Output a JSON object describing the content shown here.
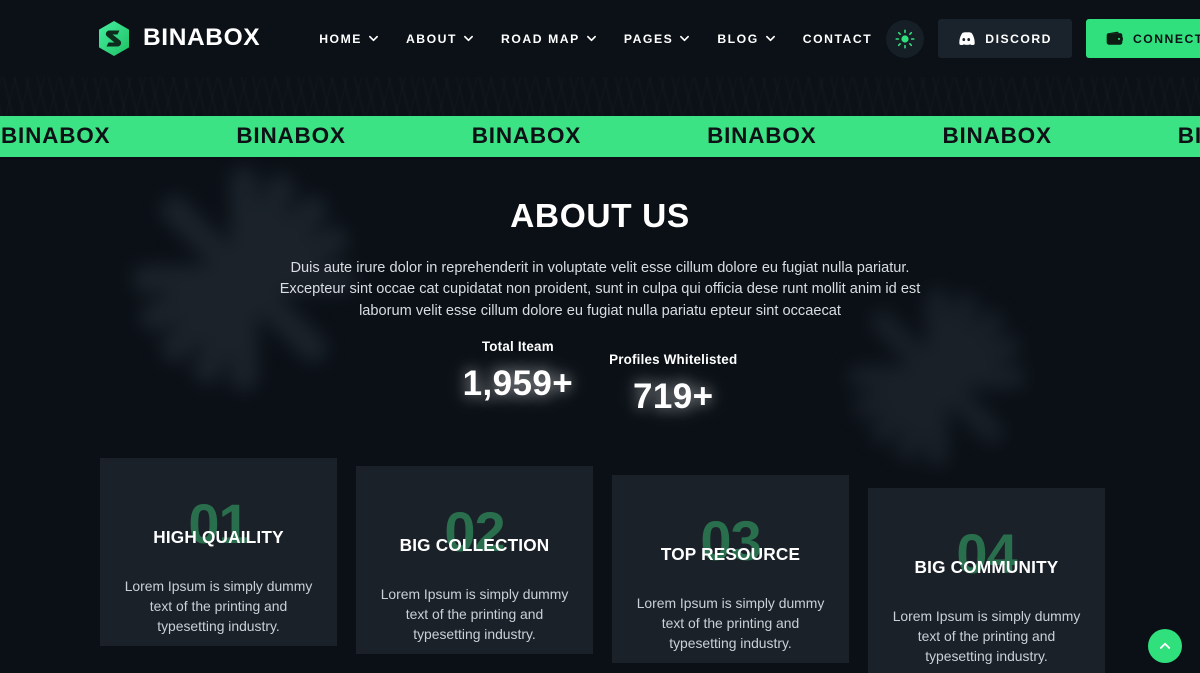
{
  "brand": {
    "name": "BINABOX",
    "logo_icon": "binabox-hexagon-logo-icon",
    "accent_color": "#2fe07c"
  },
  "header": {
    "nav": [
      {
        "label": "HOME",
        "has_dropdown": true
      },
      {
        "label": "ABOUT",
        "has_dropdown": true
      },
      {
        "label": "ROAD MAP",
        "has_dropdown": true
      },
      {
        "label": "PAGES",
        "has_dropdown": true
      },
      {
        "label": "BLOG",
        "has_dropdown": true
      },
      {
        "label": "CONTACT",
        "has_dropdown": false
      }
    ],
    "theme_toggle_icon": "sun-icon",
    "discord_button": {
      "label": "DISCORD",
      "icon": "discord-icon"
    },
    "connect_button": {
      "label": "CONNECT",
      "icon": "wallet-icon"
    }
  },
  "marquee": {
    "word": "BINABOX",
    "background_color": "#3ce384",
    "text_color": "#0d1116",
    "repeat_count": 9
  },
  "about": {
    "title": "ABOUT US",
    "paragraph": "Duis aute irure dolor in reprehenderit in voluptate velit esse cillum dolore eu fugiat nulla pariatur. Excepteur sint occae cat cupidatat non proident, sunt in culpa qui officia dese runt mollit anim id est laborum velit esse cillum dolore eu fugiat nulla pariatu epteur sint occaecat"
  },
  "stats": [
    {
      "label": "Total Iteam",
      "value": "1,959+"
    },
    {
      "label": "Profiles Whitelisted",
      "value": "719+"
    }
  ],
  "cards": [
    {
      "number": "01",
      "title": "HIGH QUAILITY",
      "text": "Lorem Ipsum is simply dummy text of the printing and typesetting industry."
    },
    {
      "number": "02",
      "title": "BIG COLLECTION",
      "text": "Lorem Ipsum is simply dummy text of the printing and typesetting industry."
    },
    {
      "number": "03",
      "title": "TOP RESOURCE",
      "text": "Lorem Ipsum is simply dummy text of the printing and typesetting industry."
    },
    {
      "number": "04",
      "title": "BIG COMMUNITY",
      "text": "Lorem Ipsum is simply dummy text of the printing and typesetting industry."
    }
  ],
  "scroll_top": {
    "icon": "chevron-up-icon",
    "color": "#2fe07c"
  },
  "decor": {
    "left_icon": "asterisk-star-icon",
    "right_icon": "asterisk-star-icon"
  }
}
